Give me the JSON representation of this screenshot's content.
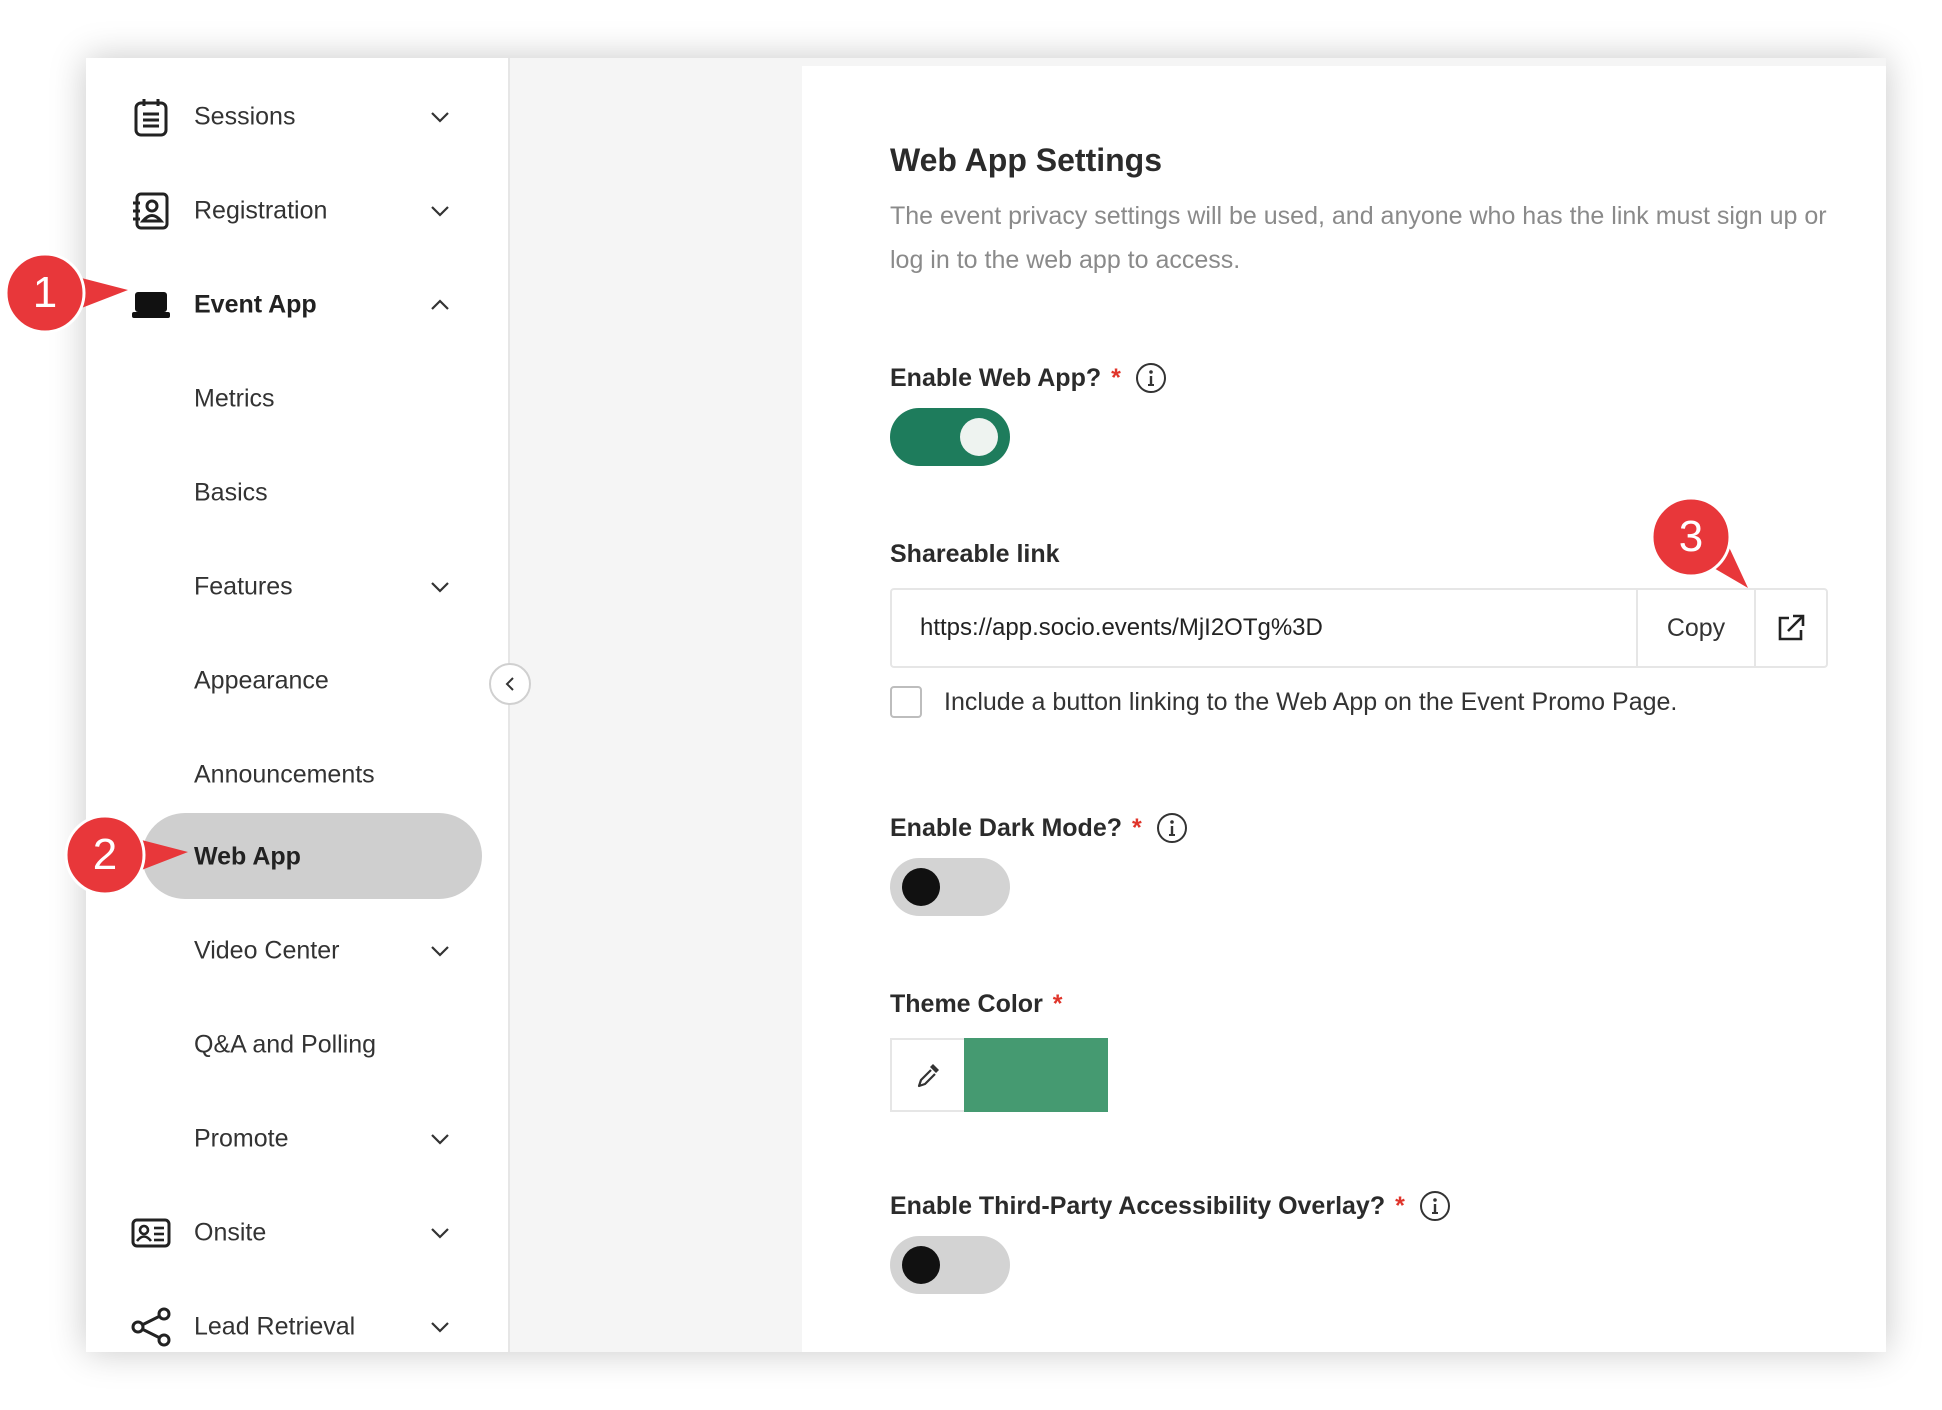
{
  "sidebar": {
    "items": [
      {
        "label": "Sessions",
        "icon": "sessions-icon"
      },
      {
        "label": "Registration",
        "icon": "registration-icon"
      },
      {
        "label": "Event App",
        "icon": "event-app-icon"
      },
      {
        "label": "Metrics"
      },
      {
        "label": "Basics"
      },
      {
        "label": "Features"
      },
      {
        "label": "Appearance"
      },
      {
        "label": "Announcements"
      },
      {
        "label": "Web App"
      },
      {
        "label": "Video Center"
      },
      {
        "label": "Q&A and Polling"
      },
      {
        "label": "Promote"
      },
      {
        "label": "Onsite",
        "icon": "onsite-icon"
      },
      {
        "label": "Lead Retrieval",
        "icon": "lead-retrieval-icon"
      }
    ],
    "active_item": "Web App"
  },
  "settings": {
    "title": "Web App Settings",
    "description": "The event privacy settings will be used, and anyone who has the link must sign up or log in to the web app to access.",
    "enable_web_app": {
      "label": "Enable Web App?",
      "required_mark": "*",
      "enabled": true
    },
    "shareable_link": {
      "label": "Shareable link",
      "value": "https://app.socio.events/MjI2OTg%3D",
      "copy_label": "Copy"
    },
    "promo_checkbox": {
      "label": "Include a button linking to the Web App on the Event Promo Page.",
      "checked": false
    },
    "enable_dark_mode": {
      "label": "Enable Dark Mode?",
      "required_mark": "*",
      "enabled": false
    },
    "theme_color": {
      "label": "Theme Color",
      "required_mark": "*",
      "value": "#459a71"
    },
    "accessibility_overlay": {
      "label": "Enable Third-Party Accessibility Overlay?",
      "required_mark": "*",
      "enabled": false
    }
  },
  "callouts": [
    {
      "number": "1"
    },
    {
      "number": "2"
    },
    {
      "number": "3"
    }
  ],
  "colors": {
    "toggle_on": "#1e7c5c",
    "active_pill": "#cfcfcf",
    "required": "#e0352b",
    "callout": "#e8373a"
  }
}
